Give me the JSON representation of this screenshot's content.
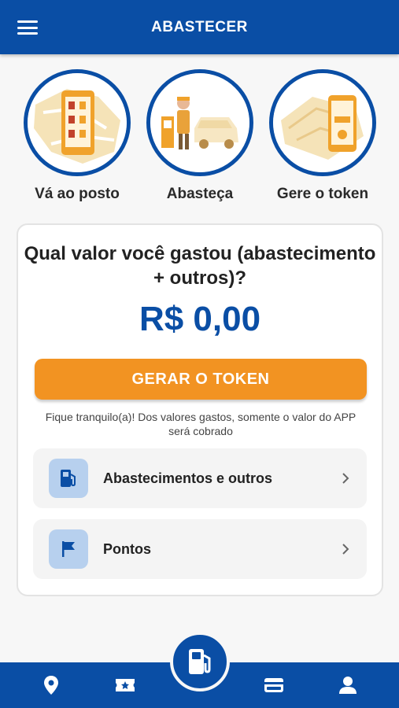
{
  "header": {
    "title": "ABASTECER",
    "menu_icon": "hamburger-menu-icon"
  },
  "steps": [
    {
      "label": "Vá ao posto",
      "illustration": "phone-map-illustration"
    },
    {
      "label": "Abasteça",
      "illustration": "attendant-car-illustration"
    },
    {
      "label": "Gere o token",
      "illustration": "phone-token-illustration"
    }
  ],
  "card": {
    "question": "Qual valor você gastou (abastecimento + outros)?",
    "amount": "R$ 0,00",
    "cta_label": "GERAR O TOKEN",
    "note": "Fique tranquilo(a)! Dos valores gastos, somente o valor do APP será cobrado",
    "rows": [
      {
        "label": "Abastecimentos e outros",
        "icon": "fuel-pump-icon"
      },
      {
        "label": "Pontos",
        "icon": "flag-icon"
      }
    ]
  },
  "bottom_nav": {
    "items": [
      "location-pin-icon",
      "ticket-star-icon",
      "fuel-pump-icon",
      "wallet-icon",
      "user-icon"
    ]
  },
  "colors": {
    "primary": "#0a4ea5",
    "accent": "#f29322",
    "icon_bg": "#b7d0ee"
  }
}
